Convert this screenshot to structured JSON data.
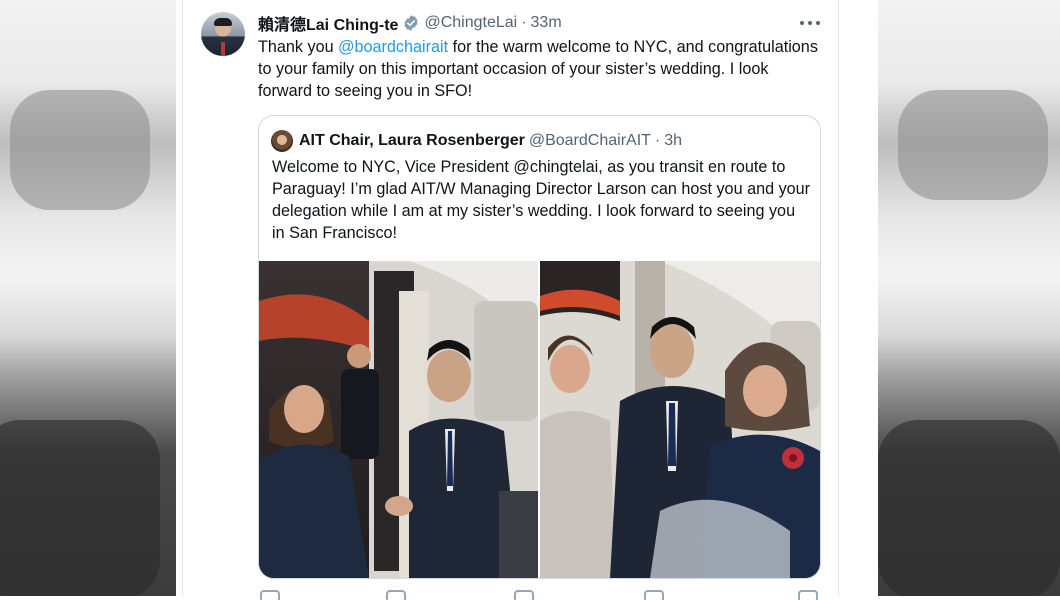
{
  "tweet": {
    "author_name": "賴清德Lai Ching-te",
    "author_handle": "@ChingteLai",
    "time_sep": "·",
    "time": "33m",
    "text_before": "Thank you ",
    "mention": "@boardchairait",
    "text_after": " for the warm welcome to NYC, and congratulations to your family on this important occasion of your sister’s wedding.   I look forward to seeing you in SFO!"
  },
  "quote": {
    "author_name": "AIT Chair, Laura Rosenberger",
    "author_handle": "@BoardChairAIT",
    "time_sep": "·",
    "time": "3h",
    "text": "Welcome to NYC, Vice President @chingtelai, as you transit en route to Paraguay! I’m glad AIT/W Managing Director Larson can host you and your delegation while I am at my sister’s wedding. I look forward to seeing you in San Francisco!"
  },
  "icons": {
    "verified": "verified-badge-icon",
    "more": "more-options-icon"
  },
  "colors": {
    "text": "#0f1419",
    "secondary": "#536471",
    "link": "#1d9bf0",
    "border": "#cfd9de",
    "verified": "#829aab"
  }
}
